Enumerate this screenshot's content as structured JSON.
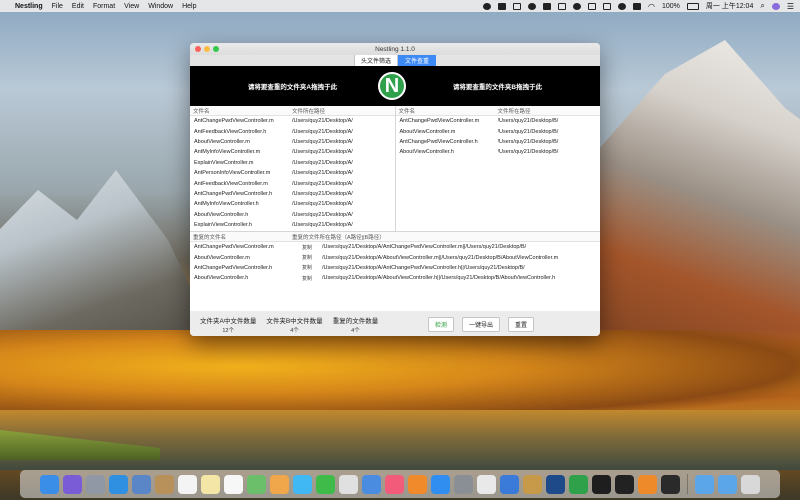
{
  "menubar": {
    "app_name": "Nestling",
    "menus": [
      "File",
      "Edit",
      "Format",
      "View",
      "Window",
      "Help"
    ],
    "battery": "100%",
    "clock": "周一 上午12:04"
  },
  "window": {
    "title": "Nestling 1.1.0",
    "tabs": [
      {
        "label": "头文件筛选",
        "active": false
      },
      {
        "label": "文件查重",
        "active": true
      }
    ],
    "drop_a": "请将要查重的文件夹A拖拽于此",
    "drop_b": "请将要查重的文件夹B拖拽于此",
    "logo_letter": "N"
  },
  "pane_a": {
    "col_name": "文件名",
    "col_path": "文件所在路径",
    "rows": [
      {
        "name": "AntChangePwdViewController.m",
        "path": "/Users/quy21/Desktop/A/"
      },
      {
        "name": "AntFeedbackViewController.h",
        "path": "/Users/quy21/Desktop/A/"
      },
      {
        "name": "AboutViewController.m",
        "path": "/Users/quy21/Desktop/A/"
      },
      {
        "name": "AntMyInfoViewController.m",
        "path": "/Users/quy21/Desktop/A/"
      },
      {
        "name": "ExplainViewController.m",
        "path": "/Users/quy21/Desktop/A/"
      },
      {
        "name": "AntPersonInfoViewController.m",
        "path": "/Users/quy21/Desktop/A/"
      },
      {
        "name": "AntFeedbackViewController.m",
        "path": "/Users/quy21/Desktop/A/"
      },
      {
        "name": "AntChangePwdViewController.h",
        "path": "/Users/quy21/Desktop/A/"
      },
      {
        "name": "AntMyInfoViewController.h",
        "path": "/Users/quy21/Desktop/A/"
      },
      {
        "name": "AboutViewController.h",
        "path": "/Users/quy21/Desktop/A/"
      },
      {
        "name": "ExplainViewController.h",
        "path": "/Users/quy21/Desktop/A/"
      }
    ]
  },
  "pane_b": {
    "col_name": "文件名",
    "col_path": "文件所在路径",
    "rows": [
      {
        "name": "AntChangePwdViewController.m",
        "path": "/Users/quy21/Desktop/B/"
      },
      {
        "name": "AboutViewController.m",
        "path": "/Users/quy21/Desktop/B/"
      },
      {
        "name": "AntChangePwdViewController.h",
        "path": "/Users/quy21/Desktop/B/"
      },
      {
        "name": "AboutViewController.h",
        "path": "/Users/quy21/Desktop/B/"
      }
    ]
  },
  "duplicates": {
    "col_name": "重复的文件名",
    "col_path": "重复的文件所在路径（A路径||B路径）",
    "copy_label": "复制",
    "rows": [
      {
        "name": "AntChangePwdViewController.m",
        "path": "/Users/quy21/Desktop/A/AntChangePwdViewController.m||/Users/quy21/Desktop/B/"
      },
      {
        "name": "AboutViewController.m",
        "path": "/Users/quy21/Desktop/A/AboutViewController.m||/Users/quy21/Desktop/B/AboutViewController.m"
      },
      {
        "name": "AntChangePwdViewController.h",
        "path": "/Users/quy21/Desktop/A/AntChangePwdViewController.h||/Users/quy21/Desktop/B/"
      },
      {
        "name": "AboutViewController.h",
        "path": "/Users/quy21/Desktop/A/AboutViewController.h||/Users/quy21/Desktop/B/AboutViewController.h"
      }
    ]
  },
  "footer": {
    "count_a_label": "文件夹A中文件数量",
    "count_a_value": "12个",
    "count_b_label": "文件夹B中文件数量",
    "count_b_value": "4个",
    "dup_label": "重复的文件数量",
    "dup_value": "4个",
    "detect_button": "检测",
    "export_button": "一键导出",
    "reset_button": "重置"
  },
  "dock": {
    "apps": [
      {
        "icon": "finder-icon",
        "color": "#3b8ee8"
      },
      {
        "icon": "siri-icon",
        "color": "#7a5cd6"
      },
      {
        "icon": "launchpad-icon",
        "color": "#8f98a4"
      },
      {
        "icon": "safari-icon",
        "color": "#2f8fe0"
      },
      {
        "icon": "preview-icon",
        "color": "#5a86c8"
      },
      {
        "icon": "notes-brown-icon",
        "color": "#b7905a"
      },
      {
        "icon": "calendar-icon",
        "color": "#f4f4f4"
      },
      {
        "icon": "stickies-icon",
        "color": "#f3e6a6"
      },
      {
        "icon": "reminders-icon",
        "color": "#f7f7f7"
      },
      {
        "icon": "maps-icon",
        "color": "#6cbf6a"
      },
      {
        "icon": "photos-icon",
        "color": "#f0a64a"
      },
      {
        "icon": "messages-icon",
        "color": "#3fb8f3"
      },
      {
        "icon": "facetime-icon",
        "color": "#3fbb4a"
      },
      {
        "icon": "numbers-icon",
        "color": "#e0e0e0"
      },
      {
        "icon": "keynote-icon",
        "color": "#4a8de0"
      },
      {
        "icon": "music-icon",
        "color": "#f25c7a"
      },
      {
        "icon": "books-icon",
        "color": "#f08a2a"
      },
      {
        "icon": "appstore-icon",
        "color": "#2f8ef0"
      },
      {
        "icon": "system-prefs-icon",
        "color": "#8a8f96"
      },
      {
        "icon": "chrome-icon",
        "color": "#e9e9e9"
      },
      {
        "icon": "xcode-icon",
        "color": "#3a7ad8"
      },
      {
        "icon": "instruments-icon",
        "color": "#c79a4a"
      },
      {
        "icon": "sourcetree-icon",
        "color": "#1f4a8a"
      },
      {
        "icon": "nestling-icon",
        "color": "#2fa14a"
      },
      {
        "icon": "terminal-icon",
        "color": "#1e1e1e"
      },
      {
        "icon": "qq-icon",
        "color": "#222222"
      },
      {
        "icon": "sublime-icon",
        "color": "#ef8a2a"
      },
      {
        "icon": "activity-icon",
        "color": "#2a2a2a"
      }
    ],
    "trailing": [
      {
        "icon": "folder-icon",
        "color": "#5aa6e8"
      },
      {
        "icon": "downloads-folder-icon",
        "color": "#5aa6e8"
      },
      {
        "icon": "trash-icon",
        "color": "#d8d8d8"
      }
    ]
  }
}
